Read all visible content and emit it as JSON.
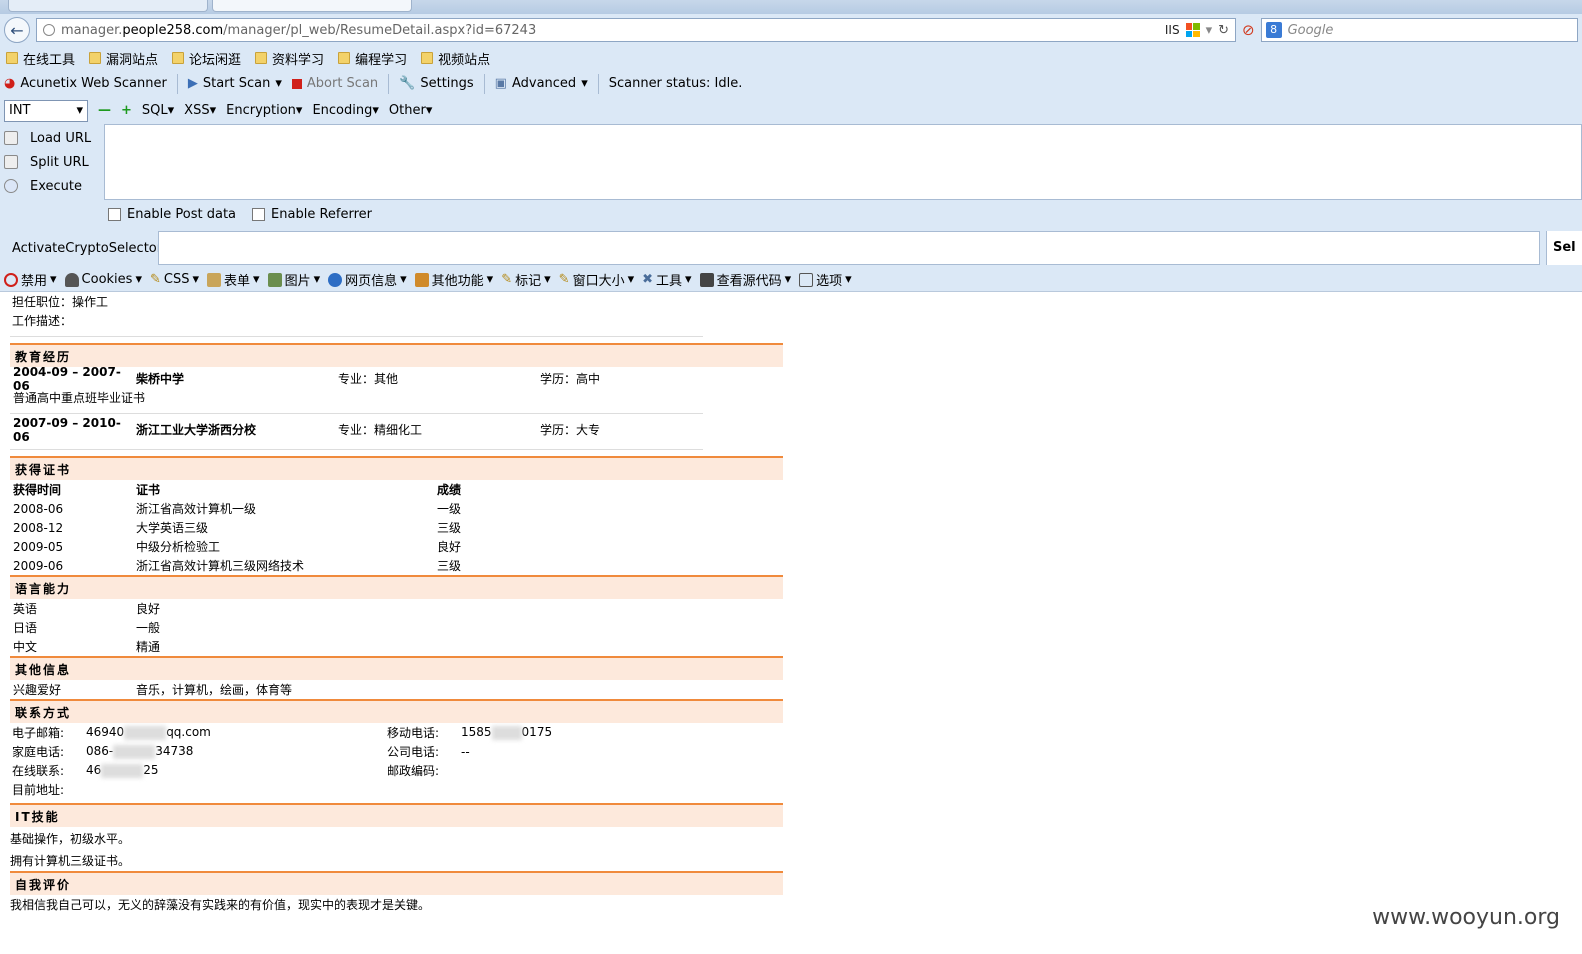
{
  "browser": {
    "url_prefix": "manager.",
    "url_domain": "people258.com",
    "url_path": "/manager/pl_web/ResumeDetail.aspx?id=67243",
    "iis_label": "IIS",
    "search_placeholder": "Google"
  },
  "bookmarks": [
    "在线工具",
    "漏洞站点",
    "论坛闲逛",
    "资料学习",
    "编程学习",
    "视频站点"
  ],
  "scanner": {
    "name": "Acunetix Web Scanner",
    "start": "Start Scan",
    "abort": "Abort Scan",
    "settings": "Settings",
    "advanced": "Advanced",
    "status": "Scanner status: Idle."
  },
  "hackbar": {
    "select_value": "INT",
    "menus": [
      "SQL",
      "XSS",
      "Encryption",
      "Encoding",
      "Other"
    ],
    "load": "Load URL",
    "split": "Split URL",
    "execute": "Execute",
    "post": "Enable Post data",
    "referrer": "Enable Referrer",
    "crypto": "ActivateCryptoSelector",
    "sel": "Sel"
  },
  "devbar": [
    "禁用",
    "Cookies",
    "CSS",
    "表单",
    "图片",
    "网页信息",
    "其他功能",
    "标记",
    "窗口大小",
    "工具",
    "查看源代码",
    "选项"
  ],
  "resume": {
    "job_position": "担任职位：操作工",
    "job_desc": "工作描述：",
    "edu_title": "教育经历",
    "edu": [
      {
        "period": "2004-09 – 2007-06",
        "school": "柴桥中学",
        "major": "专业：其他",
        "degree": "学历：高中",
        "note": "普通高中重点班毕业证书"
      },
      {
        "period": "2007-09 – 2010-06",
        "school": "浙江工业大学浙西分校",
        "major": "专业：精细化工",
        "degree": "学历：大专",
        "note": ""
      }
    ],
    "cert_title": "获得证书",
    "cert_headers": [
      "获得时间",
      "证书",
      "成绩"
    ],
    "certs": [
      [
        "2008-06",
        "浙江省高效计算机一级",
        "一级"
      ],
      [
        "2008-12",
        "大学英语三级",
        "三级"
      ],
      [
        "2009-05",
        "中级分析检验工",
        "良好"
      ],
      [
        "2009-06",
        "浙江省高效计算机三级网络技术",
        "三级"
      ]
    ],
    "lang_title": "语言能力",
    "langs": [
      [
        "英语",
        "良好"
      ],
      [
        "日语",
        "一般"
      ],
      [
        "中文",
        "精通"
      ]
    ],
    "other_title": "其他信息",
    "hobby_label": "兴趣爱好",
    "hobby_value": "音乐，计算机，绘画，体育等",
    "contact_title": "联系方式",
    "email_label": "电子邮箱:",
    "email_a": "46940",
    "email_b": "qq.com",
    "mobile_label": "移动电话:",
    "mobile_a": "1585",
    "mobile_b": "0175",
    "home_label": "家庭电话:",
    "home_a": "086-",
    "home_b": "34738",
    "office_label": "公司电话:",
    "office_value": "--",
    "online_label": "在线联系:",
    "online_a": "46",
    "online_b": "25",
    "zip_label": "邮政编码:",
    "addr_label": "目前地址:",
    "it_title": "IT技能",
    "it_lines": [
      "基础操作，初级水平。",
      "拥有计算机三级证书。"
    ],
    "self_title": "自我评价",
    "self_text": "我相信我自己可以，无义的辞藻没有实践来的有价值，现实中的表现才是关键。"
  },
  "watermark": "www.wooyun.org"
}
